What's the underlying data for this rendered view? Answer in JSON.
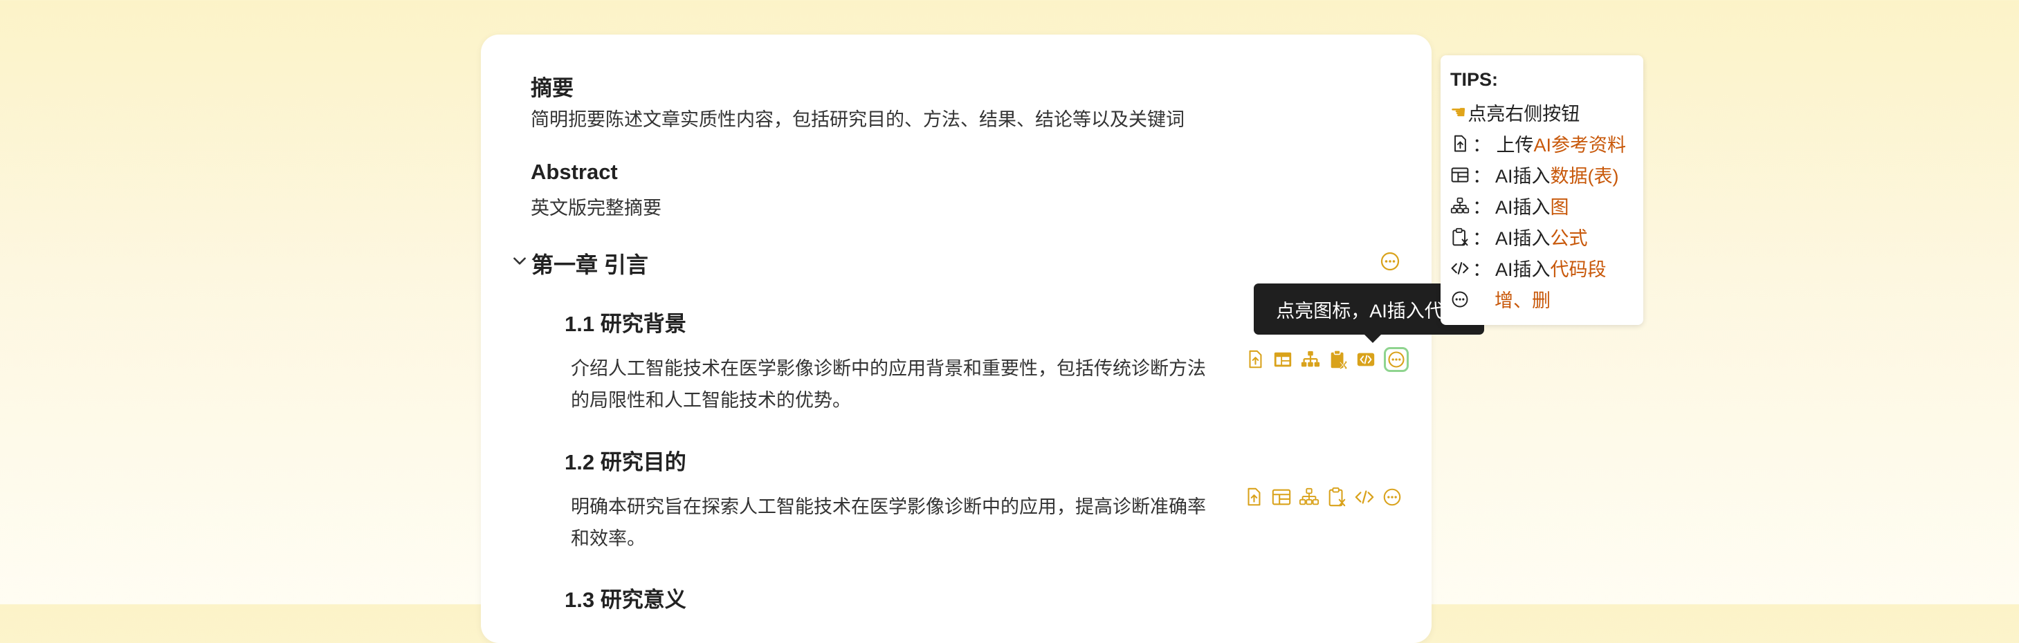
{
  "document": {
    "abstract_cn": {
      "title": "摘要",
      "body": "简明扼要陈述文章实质性内容，包括研究目的、方法、结果、结论等以及关键词"
    },
    "abstract_en": {
      "title": "Abstract",
      "body": "英文版完整摘要"
    },
    "chapter": {
      "title": "第一章  引言",
      "sections": [
        {
          "title": "1.1  研究背景",
          "body": "介绍人工智能技术在医学影像诊断中的应用背景和重要性，包括传统诊断方法的局限性和人工智能技术的优势。"
        },
        {
          "title": "1.2  研究目的",
          "body": "明确本研究旨在探索人工智能技术在医学影像诊断中的应用，提高诊断准确率和效率。"
        },
        {
          "title": "1.3  研究意义"
        }
      ]
    }
  },
  "tooltip": {
    "text": "点亮图标，AI插入代码"
  },
  "tips": {
    "title": "TIPS:",
    "hint": "点亮右侧按钮",
    "items": [
      {
        "icon": "upload-icon",
        "prefix": "：  上传",
        "highlight": "AI参考资料"
      },
      {
        "icon": "table-icon",
        "prefix": "：  AI插入",
        "highlight": "数据(表)"
      },
      {
        "icon": "diagram-icon",
        "prefix": "：  AI插入",
        "highlight": "图"
      },
      {
        "icon": "formula-icon",
        "prefix": "：  AI插入",
        "highlight": "公式"
      },
      {
        "icon": "code-icon",
        "prefix": "：  AI插入",
        "highlight": "代码段"
      },
      {
        "icon": "more-icon",
        "prefix": "",
        "highlight": "增、删"
      }
    ]
  },
  "colors": {
    "accent": "#d9a21b",
    "highlight_text": "#c8580a",
    "active_border": "#8fd48f",
    "tooltip_bg": "#1f1f1f"
  }
}
